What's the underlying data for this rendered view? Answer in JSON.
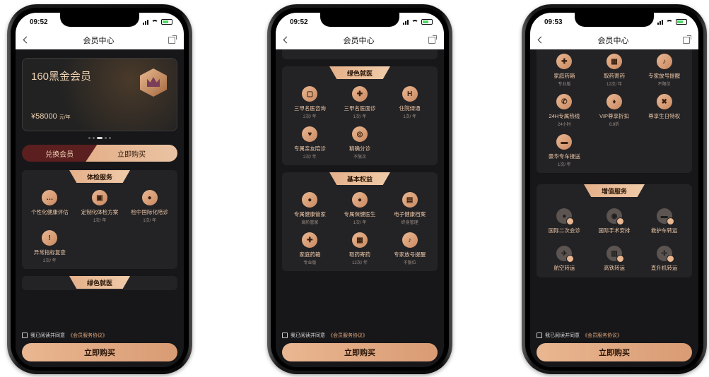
{
  "screens": [
    {
      "time": "09:52",
      "nav_title": "会员中心",
      "card": {
        "name": "160黑金会员",
        "price": "¥58000",
        "unit": "元/年"
      },
      "tabs": [
        "兑换会员",
        "立即购买"
      ],
      "sections": [
        {
          "title": "体检服务",
          "items": [
            {
              "icon": "chat-icon",
              "glyph": "…",
              "label": "个性化健康评估",
              "sub": ""
            },
            {
              "icon": "lock-icon",
              "glyph": "▣",
              "label": "定制化体检方案",
              "sub": "1次/ 年"
            },
            {
              "icon": "users-icon",
              "glyph": "●",
              "label": "检中国际化陪诊",
              "sub": "1次/ 年"
            },
            {
              "icon": "alert-icon",
              "glyph": "!",
              "label": "异常指标复查",
              "sub": "2次/ 年"
            }
          ]
        },
        {
          "title": "绿色就医",
          "items": []
        }
      ],
      "agree": {
        "text": "我已阅读并同意",
        "link": "《会员服务协议》"
      },
      "buy_label": "立即购买"
    },
    {
      "time": "09:52",
      "nav_title": "会员中心",
      "sections": [
        {
          "title": "绿色就医",
          "items": [
            {
              "icon": "monitor-icon",
              "glyph": "▢",
              "label": "三甲名医咨询",
              "sub": "2次/ 年"
            },
            {
              "icon": "doctor-icon",
              "glyph": "✚",
              "label": "三甲名医面诊",
              "sub": "1次/ 年"
            },
            {
              "icon": "hospital-icon",
              "glyph": "H",
              "label": "住院绿通",
              "sub": "1次/ 年"
            },
            {
              "icon": "companion-icon",
              "glyph": "♥",
              "label": "专属亲友陪诊",
              "sub": "2次/ 年"
            },
            {
              "icon": "target-icon",
              "glyph": "◎",
              "label": "精确分诊",
              "sub": "不限次"
            }
          ]
        },
        {
          "title": "基本权益",
          "items": [
            {
              "icon": "person-icon",
              "glyph": "●",
              "label": "专属健康管家",
              "sub": "高阶管家"
            },
            {
              "icon": "nurse-icon",
              "glyph": "●",
              "label": "专属保健医生",
              "sub": "1次/ 年"
            },
            {
              "icon": "folder-icon",
              "glyph": "▤",
              "label": "电子健康档案",
              "sub": "终身管理"
            },
            {
              "icon": "medkit-icon",
              "glyph": "✚",
              "label": "家庭药箱",
              "sub": "专业版"
            },
            {
              "icon": "calendar-icon",
              "glyph": "▦",
              "label": "取药寄药",
              "sub": "12次/ 年"
            },
            {
              "icon": "bell-icon",
              "glyph": "♪",
              "label": "专家放号提醒",
              "sub": "不限位"
            }
          ]
        }
      ],
      "agree": {
        "text": "我已阅读并同意",
        "link": "《会员服务协议》"
      },
      "buy_label": "立即购买"
    },
    {
      "time": "09:53",
      "nav_title": "会员中心",
      "sections": [
        {
          "title": "",
          "items": [
            {
              "icon": "medkit-icon",
              "glyph": "✚",
              "label": "家庭药箱",
              "sub": "专业版"
            },
            {
              "icon": "calendar-icon",
              "glyph": "▦",
              "label": "取药寄药",
              "sub": "12次/ 年"
            },
            {
              "icon": "bell-icon",
              "glyph": "♪",
              "label": "专家放号提醒",
              "sub": "不限位"
            },
            {
              "icon": "phone-icon",
              "glyph": "✆",
              "label": "24H专属热线",
              "sub": "24小时"
            },
            {
              "icon": "vip-icon",
              "glyph": "♦",
              "label": "VIP尊享折扣",
              "sub": "8.8折"
            },
            {
              "icon": "gift-icon",
              "glyph": "✖",
              "label": "尊享生日特权",
              "sub": ""
            },
            {
              "icon": "car-icon",
              "glyph": "▬",
              "label": "豪华专车接送",
              "sub": "1次/ 年"
            }
          ]
        },
        {
          "title": "增值服务",
          "items": [
            {
              "icon": "consult-icon",
              "glyph": "●",
              "label": "国际二次会诊",
              "sub": ""
            },
            {
              "icon": "surgery-icon",
              "glyph": "◉",
              "label": "国际手术安排",
              "sub": ""
            },
            {
              "icon": "ambulance-icon",
              "glyph": "▬",
              "label": "救护车转运",
              "sub": ""
            },
            {
              "icon": "plane-icon",
              "glyph": "✈",
              "label": "航空转运",
              "sub": ""
            },
            {
              "icon": "train-icon",
              "glyph": "▥",
              "label": "高铁转运",
              "sub": ""
            },
            {
              "icon": "helicopter-icon",
              "glyph": "✢",
              "label": "直升机转运",
              "sub": ""
            }
          ]
        }
      ],
      "agree": {
        "text": "我已阅读并同意",
        "link": "《会员服务协议》"
      },
      "buy_label": "立即购买"
    }
  ]
}
